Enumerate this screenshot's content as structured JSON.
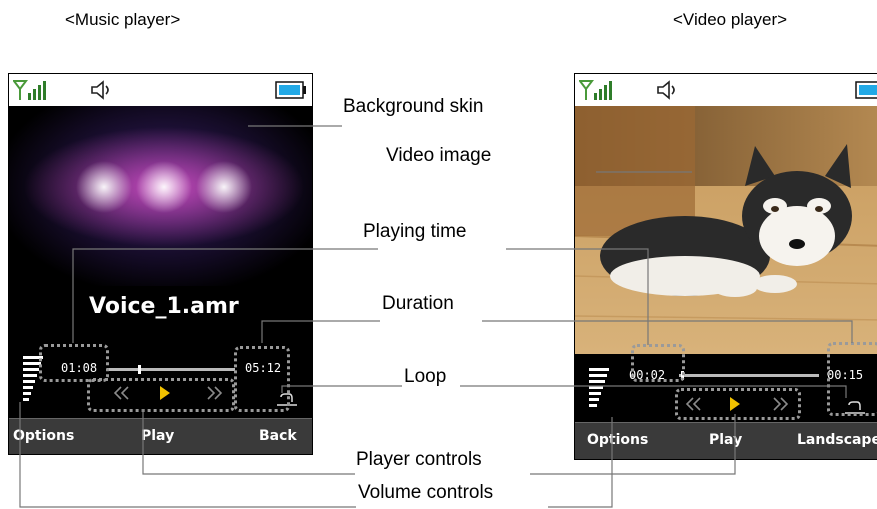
{
  "titles": {
    "music": "<Music player>",
    "video": "<Video player>"
  },
  "music_player": {
    "track_name": "Voice_1.amr",
    "elapsed": "01:08",
    "duration": "05:12",
    "softkeys": {
      "left": "Options",
      "center": "Play",
      "right": "Back"
    }
  },
  "video_player": {
    "elapsed": "00:02",
    "duration": "00:15",
    "softkeys": {
      "left": "Options",
      "center": "Play",
      "right": "Landscape"
    }
  },
  "callouts": {
    "background_skin": "Background skin",
    "video_image": "Video image",
    "playing_time": "Playing time",
    "duration": "Duration",
    "loop": "Loop",
    "player_controls": "Player controls",
    "volume_controls": "Volume controls"
  },
  "icons": {
    "status": [
      "signal-icon",
      "speaker-icon",
      "battery-icon"
    ],
    "controls": [
      "rewind-icon",
      "play-icon",
      "fast-forward-icon"
    ],
    "loop": "loop-icon"
  },
  "colors": {
    "softkey_bar": "#3a3a3a",
    "battery": "#22a9e6",
    "play_arrow": "#f2c200",
    "dotted_highlight": "#9a9a9a"
  }
}
